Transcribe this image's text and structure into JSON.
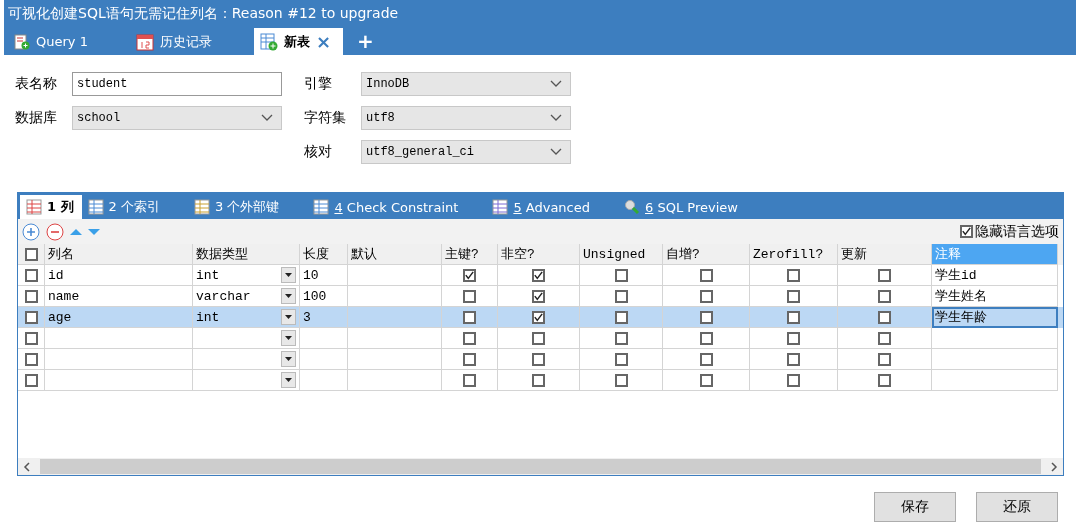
{
  "window": {
    "title": "可视化创建SQL语句无需记住列名：Reason #12 to upgrade"
  },
  "tabs": [
    {
      "label": "Query 1",
      "kind": "query",
      "selected": false,
      "closable": false
    },
    {
      "label": "历史记录",
      "kind": "calendar",
      "selected": false,
      "closable": false
    },
    {
      "label": "新表",
      "kind": "table",
      "selected": true,
      "closable": true
    }
  ],
  "new_tab": "+",
  "close_mark": "×",
  "form": {
    "left": [
      {
        "label": "表名称",
        "kind": "text",
        "value": "student"
      },
      {
        "label": "数据库",
        "kind": "select",
        "value": "school"
      }
    ],
    "right": [
      {
        "label": "引擎",
        "kind": "select",
        "value": "InnoDB"
      },
      {
        "label": "字符集",
        "kind": "select",
        "value": "utf8"
      },
      {
        "label": "核对",
        "kind": "select",
        "value": "utf8_general_ci"
      }
    ]
  },
  "subtabs": [
    {
      "number": "1",
      "label": "列",
      "selected": true
    },
    {
      "number": "2",
      "label": "个索引",
      "selected": false
    },
    {
      "number": "3",
      "label": "个外部键",
      "selected": false
    },
    {
      "number": "4",
      "label": "Check Constraint",
      "selected": false
    },
    {
      "number": "5",
      "label": "Advanced",
      "selected": false
    },
    {
      "number": "6",
      "label": "SQL Preview",
      "selected": false
    }
  ],
  "hide_language": {
    "label": "隐藏语言选项",
    "checked": true
  },
  "table": {
    "header_checked": false,
    "columns": [
      "列名",
      "数据类型",
      "长度",
      "默认",
      "主键?",
      "非空?",
      "Unsigned",
      "自增?",
      "Zerofill?",
      "更新",
      "注释"
    ],
    "rows": [
      {
        "checked": false,
        "selected": false,
        "name": "id",
        "type": "int",
        "length": "10",
        "primary": true,
        "not_null": true,
        "unsigned": false,
        "auto_inc": false,
        "zerofill": false,
        "update": false,
        "comment": "学生id"
      },
      {
        "checked": false,
        "selected": false,
        "name": "name",
        "type": "varchar",
        "length": "100",
        "primary": false,
        "not_null": true,
        "unsigned": false,
        "auto_inc": false,
        "zerofill": false,
        "update": false,
        "comment": "学生姓名"
      },
      {
        "checked": false,
        "selected": true,
        "name": "age",
        "type": "int",
        "length": "3",
        "primary": false,
        "not_null": true,
        "unsigned": false,
        "auto_inc": false,
        "zerofill": false,
        "update": false,
        "comment": "学生年龄"
      },
      {
        "checked": false,
        "selected": false,
        "primary": false,
        "not_null": false,
        "unsigned": false,
        "auto_inc": false,
        "zerofill": false,
        "update": false
      },
      {
        "checked": false,
        "selected": false,
        "primary": false,
        "not_null": false,
        "unsigned": false,
        "auto_inc": false,
        "zerofill": false,
        "update": false
      },
      {
        "checked": false,
        "selected": false,
        "primary": false,
        "not_null": false,
        "unsigned": false,
        "auto_inc": false,
        "zerofill": false,
        "update": false
      }
    ]
  },
  "buttons": [
    "保存",
    "还原"
  ]
}
